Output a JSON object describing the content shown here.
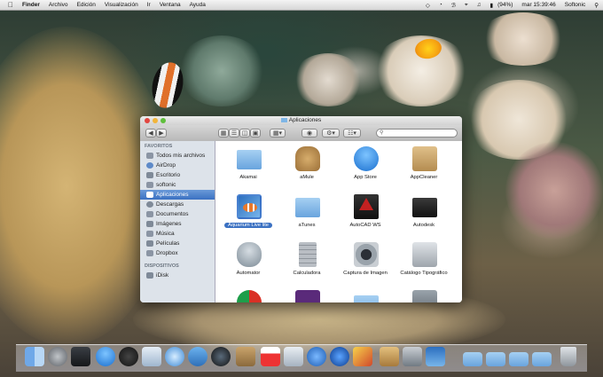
{
  "menubar": {
    "apple_icon": "apple-icon",
    "app_name": "Finder",
    "items": [
      "Archivo",
      "Edición",
      "Visualización",
      "Ir",
      "Ventana",
      "Ayuda"
    ],
    "battery": "(94%)",
    "clock": "mar 15:39:46",
    "user": "Softonic"
  },
  "window": {
    "title": "Aplicaciones",
    "search_placeholder": ""
  },
  "sidebar": {
    "favorites_header": "FAVORITOS",
    "favorites": [
      {
        "label": "Todos mis archivos",
        "icon": "all-files-icon"
      },
      {
        "label": "AirDrop",
        "icon": "airdrop-icon"
      },
      {
        "label": "Escritorio",
        "icon": "desktop-icon"
      },
      {
        "label": "softonic",
        "icon": "home-icon"
      },
      {
        "label": "Aplicaciones",
        "icon": "applications-icon",
        "selected": true
      },
      {
        "label": "Descargas",
        "icon": "downloads-icon"
      },
      {
        "label": "Documentos",
        "icon": "documents-icon"
      },
      {
        "label": "Imágenes",
        "icon": "pictures-icon"
      },
      {
        "label": "Música",
        "icon": "music-icon"
      },
      {
        "label": "Películas",
        "icon": "movies-icon"
      },
      {
        "label": "Dropbox",
        "icon": "dropbox-icon"
      }
    ],
    "devices_header": "DISPOSITIVOS",
    "devices": [
      {
        "label": "iDisk",
        "icon": "idisk-icon"
      }
    ]
  },
  "apps": [
    {
      "label": "Akamai",
      "icon": "folder-icon",
      "color": "#7fb6e6"
    },
    {
      "label": "aMule",
      "icon": "donkey-icon",
      "color": "#c79a5a"
    },
    {
      "label": "App Store",
      "icon": "app-store-icon",
      "color": "#2a7fd8"
    },
    {
      "label": "AppCleaner",
      "icon": "box-icon",
      "color": "#c9a368"
    },
    {
      "label": "Aquarium Live lite",
      "icon": "clownfish-icon",
      "color": "#e8792c",
      "selected": true
    },
    {
      "label": "aTunes",
      "icon": "folder-icon",
      "color": "#7fb6e6"
    },
    {
      "label": "AutoCAD WS",
      "icon": "autocad-icon",
      "color": "#b62020"
    },
    {
      "label": "Autodesk",
      "icon": "autodesk-icon",
      "color": "#222222"
    },
    {
      "label": "Automator",
      "icon": "robot-icon",
      "color": "#8a9aa8"
    },
    {
      "label": "Calculadora",
      "icon": "calculator-icon",
      "color": "#9aa0a6"
    },
    {
      "label": "Captura de Imagen",
      "icon": "camera-icon",
      "color": "#6f7a84"
    },
    {
      "label": "Catálogo Tipográfico",
      "icon": "font-book-icon",
      "color": "#8a8f96"
    }
  ],
  "dock": {
    "apps": [
      "finder-icon",
      "launchpad-icon",
      "mission-control-icon",
      "app-store-icon",
      "dashboard-icon",
      "preview-icon",
      "safari-icon",
      "facetime-icon",
      "photobooth-icon",
      "address-book-icon",
      "calendar-icon",
      "itunes-icon",
      "quicktime-icon",
      "spotlight-icon",
      "maps-icon",
      "itunes-store-icon",
      "system-preferences-icon",
      "iphoto-icon",
      "aquarium-icon"
    ],
    "stacks": [
      "applications-stack-icon",
      "documents-stack-icon",
      "downloads-stack-icon",
      "folder-stack-icon"
    ],
    "trash": "trash-icon"
  },
  "colors": {
    "selection": "#3b71c2",
    "sidebar_bg": "#dde3ea",
    "close": "#e2463f",
    "minimize": "#f2b53a",
    "zoom": "#5fbf3c"
  }
}
